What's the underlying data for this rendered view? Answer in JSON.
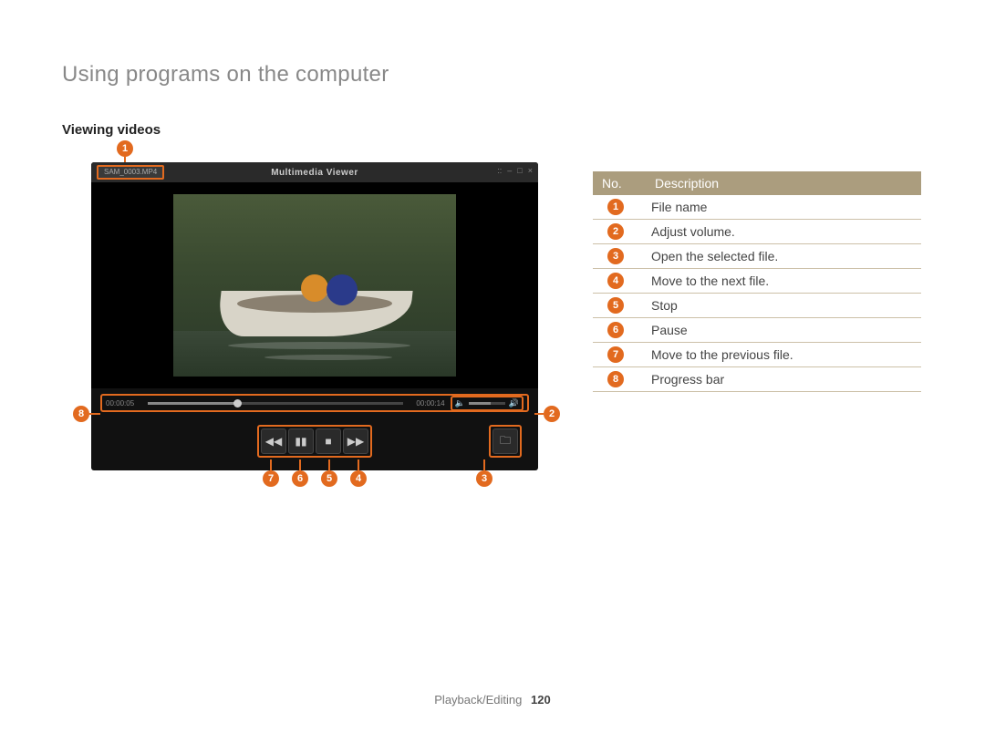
{
  "page_title": "Using programs on the computer",
  "section_title": "Viewing videos",
  "viewer": {
    "title": "Multimedia Viewer",
    "file_name": "SAM_0003.MP4",
    "time_elapsed": "00:00:05",
    "time_total": "00:00:14"
  },
  "callouts": {
    "c1": "1",
    "c2": "2",
    "c3": "3",
    "c4": "4",
    "c5": "5",
    "c6": "6",
    "c7": "7",
    "c8": "8"
  },
  "table": {
    "header_no": "No.",
    "header_desc": "Description",
    "rows": [
      {
        "num": "1",
        "text": "File name"
      },
      {
        "num": "2",
        "text": "Adjust volume."
      },
      {
        "num": "3",
        "text": "Open the selected file."
      },
      {
        "num": "4",
        "text": "Move to the next file."
      },
      {
        "num": "5",
        "text": "Stop"
      },
      {
        "num": "6",
        "text": "Pause"
      },
      {
        "num": "7",
        "text": "Move to the previous file."
      },
      {
        "num": "8",
        "text": "Progress bar"
      }
    ]
  },
  "footer": {
    "section": "Playback/Editing",
    "page": "120"
  }
}
